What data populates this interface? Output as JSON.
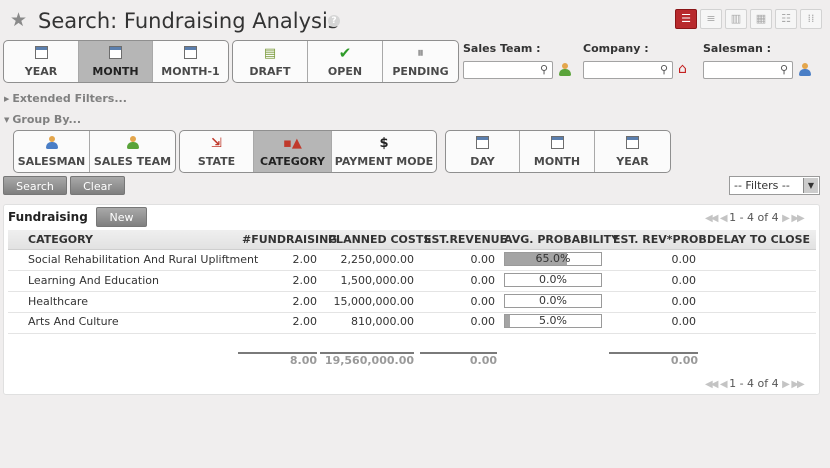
{
  "header": {
    "title": "Search: Fundraising Analysis",
    "help_label": "?"
  },
  "date_filters": [
    "YEAR",
    "MONTH",
    "MONTH-1"
  ],
  "state_filters": [
    "DRAFT",
    "OPEN",
    "PENDING"
  ],
  "search_fields": {
    "sales_team_label": "Sales Team :",
    "company_label": "Company :",
    "salesman_label": "Salesman :"
  },
  "extended_filters_label": "Extended Filters...",
  "group_by_label": "Group By...",
  "group_by": {
    "people": [
      "SALESMAN",
      "SALES TEAM"
    ],
    "attrs": [
      "STATE",
      "CATEGORY",
      "PAYMENT MODE"
    ],
    "period": [
      "DAY",
      "MONTH",
      "YEAR"
    ]
  },
  "actions": {
    "search": "Search",
    "clear": "Clear",
    "filters_select": "-- Filters --"
  },
  "list": {
    "title": "Fundraising",
    "new_label": "New",
    "pager": "1 - 4 of 4",
    "columns": [
      "CATEGORY",
      "#FUNDRAISING",
      "PLANNED COSTS",
      "EST.REVENUE",
      "AVG. PROBABILITY",
      "EST. REV*PROB.",
      "DELAY TO CLOSE"
    ],
    "rows": [
      {
        "category": "Social Rehabilitation And Rural Upliftment",
        "count": "2.00",
        "planned": "2,250,000.00",
        "revenue": "0.00",
        "probability": 65.0,
        "probability_label": "65.0%",
        "rev_prob": "0.00"
      },
      {
        "category": "Learning And Education",
        "count": "2.00",
        "planned": "1,500,000.00",
        "revenue": "0.00",
        "probability": 0.0,
        "probability_label": "0.0%",
        "rev_prob": "0.00"
      },
      {
        "category": "Healthcare",
        "count": "2.00",
        "planned": "15,000,000.00",
        "revenue": "0.00",
        "probability": 0.0,
        "probability_label": "0.0%",
        "rev_prob": "0.00"
      },
      {
        "category": "Arts And Culture",
        "count": "2.00",
        "planned": "810,000.00",
        "revenue": "0.00",
        "probability": 5.0,
        "probability_label": "5.0%",
        "rev_prob": "0.00"
      }
    ],
    "totals": {
      "count": "8.00",
      "planned": "19,560,000.00",
      "revenue": "0.00",
      "rev_prob": "0.00"
    }
  },
  "colors": {
    "active_view": "#b8292c",
    "selected_button": "#b6b6b6"
  }
}
